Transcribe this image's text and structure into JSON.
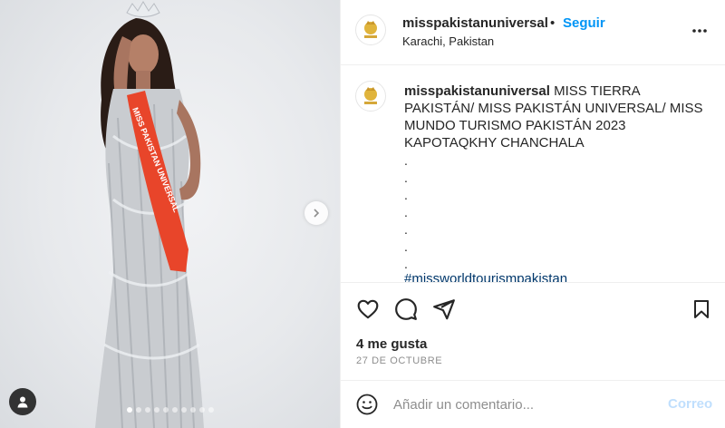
{
  "post": {
    "username": "misspakistanuniversal",
    "separator": "•",
    "follow_label": "Seguir",
    "location": "Karachi, Pakistan",
    "more_icon": "more-horizontal-icon",
    "sash_text": "MISS PAKISTAN UNIVERSAL",
    "carousel": {
      "total": 10,
      "active_index": 0
    }
  },
  "caption": {
    "username": "misspakistanuniversal",
    "text": "MISS TIERRA PAKISTÁN/ MISS PAKISTÁN UNIVERSAL/ MISS MUNDO TURISMO PAKISTÁN 2023 KAPOTAQKHY CHANCHALA",
    "dots": [
      ".",
      ".",
      ".",
      ".",
      ".",
      ".",
      "."
    ],
    "hashtag": "#missworldtourismpakistan"
  },
  "engagement": {
    "likes": "4 me gusta",
    "date": "27 DE OCTUBRE"
  },
  "comment": {
    "placeholder": "Añadir un comentario...",
    "post_label": "Correo"
  },
  "colors": {
    "link_blue": "#0095f6",
    "post_disabled": "#c0dffd",
    "sash_red": "#e8452a",
    "hashtag": "#00376b"
  }
}
